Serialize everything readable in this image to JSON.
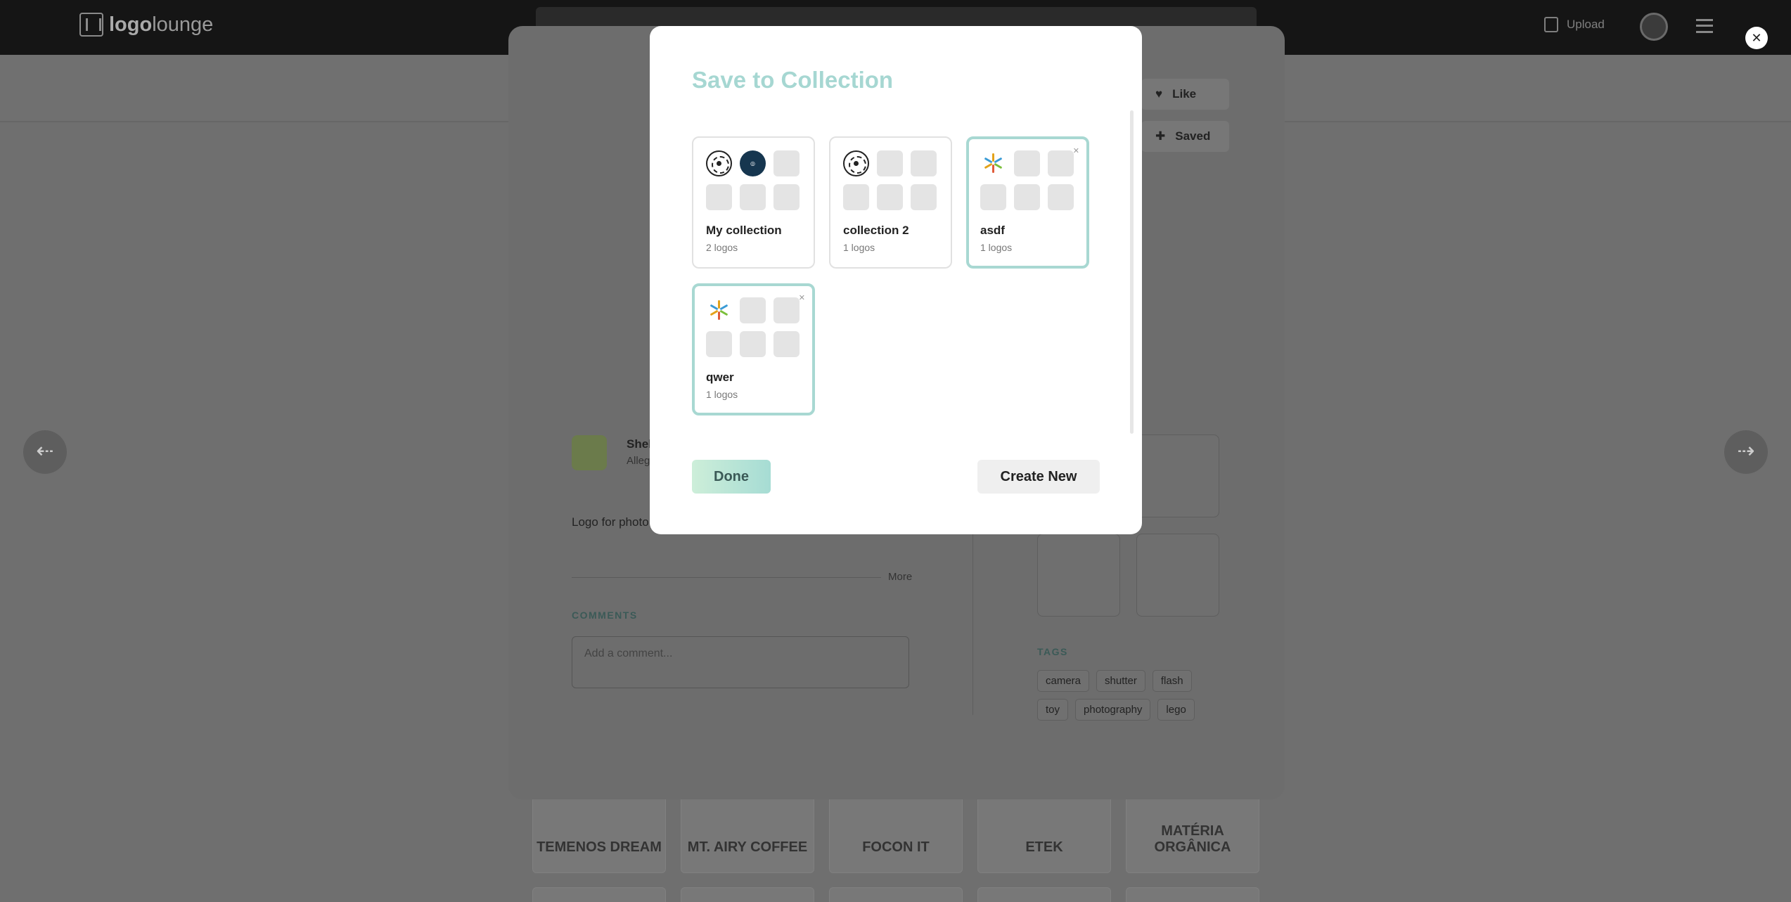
{
  "header": {
    "logo_bold": "logo",
    "logo_light": "lounge",
    "upload_label": "Upload"
  },
  "gallery": {
    "row1": [
      "TEMENOS DREAM",
      "MT. AIRY COFFEE",
      "FOCON IT",
      "ETEK",
      "MATÉRIA ORGÂNICA"
    ]
  },
  "detail": {
    "like_label": "Like",
    "saved_label": "Saved",
    "designer_name": "Shel",
    "designer_sub": "Alleg",
    "description": "Logo for photo minifigures, in magical worlds",
    "more_label": "More",
    "comments_heading": "COMMENTS",
    "comment_placeholder": "Add a comment...",
    "tags_heading": "TAGS",
    "tags": [
      "camera",
      "shutter",
      "flash",
      "toy",
      "photography",
      "lego"
    ]
  },
  "modal": {
    "title": "Save to Collection",
    "collections": [
      {
        "name": "My collection",
        "count": "2 logos",
        "selected": false
      },
      {
        "name": "collection 2",
        "count": "1 logos",
        "selected": false
      },
      {
        "name": "asdf",
        "count": "1 logos",
        "selected": true
      },
      {
        "name": "qwer",
        "count": "1 logos",
        "selected": true
      }
    ],
    "done_label": "Done",
    "create_label": "Create New"
  },
  "colors": {
    "accent_teal": "#a6d7d2",
    "header_bg": "#151515",
    "overlay": "#6f6f6f"
  }
}
